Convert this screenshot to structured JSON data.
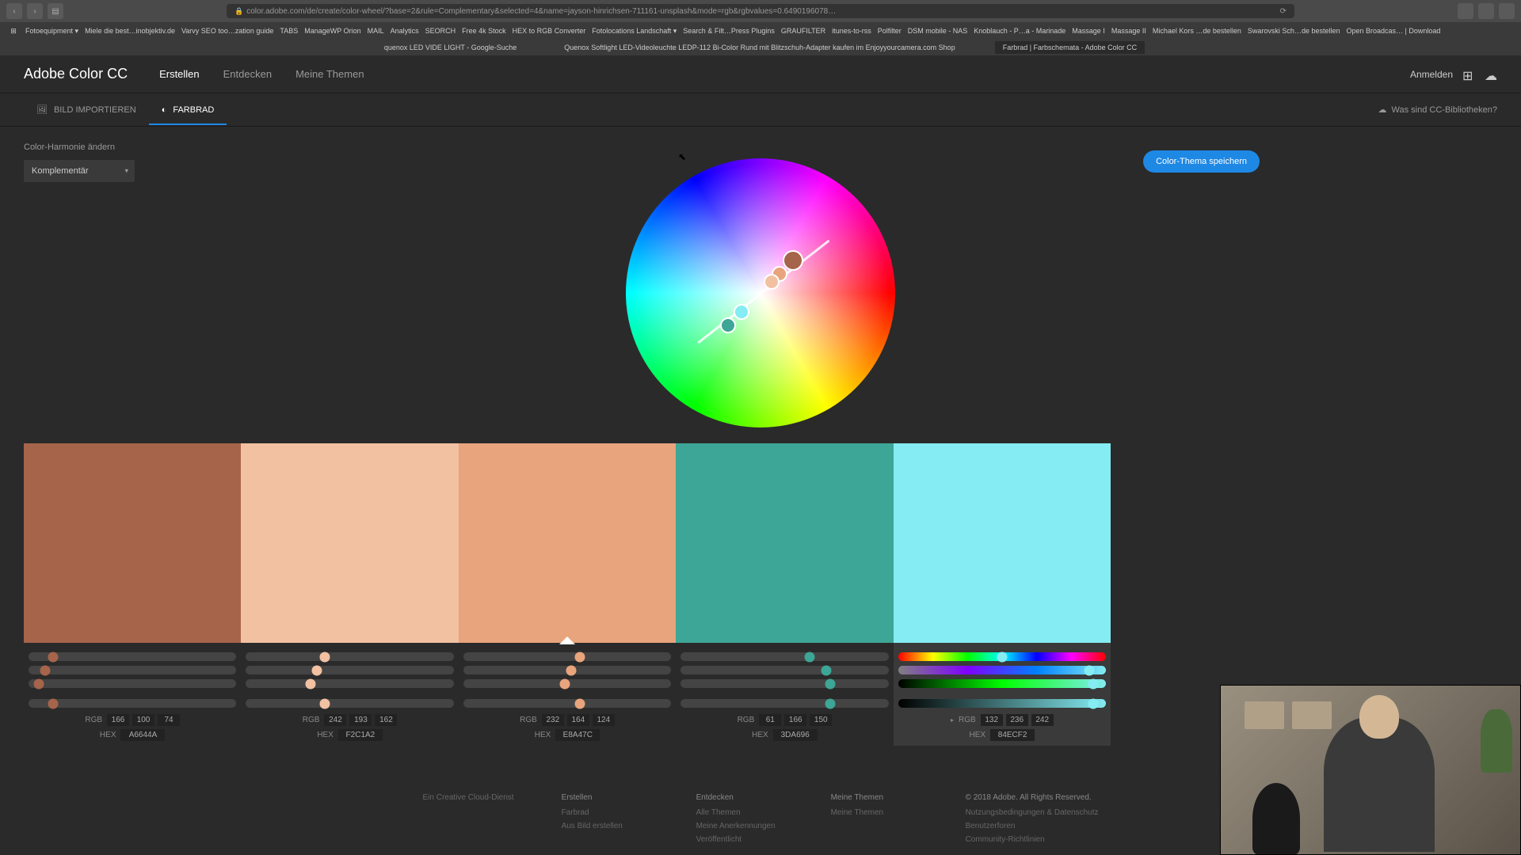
{
  "browser": {
    "url": "color.adobe.com/de/create/color-wheel/?base=2&rule=Complementary&selected=4&name=jayson-hinrichsen-711161-unsplash&mode=rgb&rgbvalues=0.6490196078…",
    "bookmarks": [
      "Fotoequipment ▾",
      "Miele die best…inobjektiv.de",
      "Varvy SEO too…zation guide",
      "TABS",
      "ManageWP Orion",
      "MAIL",
      "Analytics",
      "SEORCH",
      "Free 4k Stock",
      "HEX to RGB Converter",
      "Fotolocations Landschaft ▾",
      "Search & Filt…Press Plugins",
      "GRAUFILTER",
      "itunes-to-rss",
      "Polfilter",
      "DSM mobile - NAS",
      "Knoblauch - P…a - Marinade",
      "Massage I",
      "Massage II",
      "Michael Kors …de bestellen",
      "Swarovski Sch…de bestellen",
      "Open Broadcas… | Download"
    ],
    "tabs": [
      "quenox LED VIDE LIGHT - Google-Suche",
      "Quenox Softlight LED-Videoleuchte LEDP-112 Bi-Color Rund mit Blitzschuh-Adapter kaufen im Enjoyyourcamera.com Shop",
      "Farbrad | Farbschemata - Adobe Color CC"
    ]
  },
  "app": {
    "logo": "Adobe Color CC",
    "nav": [
      "Erstellen",
      "Entdecken",
      "Meine Themen"
    ],
    "login": "Anmelden"
  },
  "subtabs": {
    "import": "BILD IMPORTIEREN",
    "wheel": "FARBRAD",
    "cc_info": "Was sind CC-Bibliotheken?"
  },
  "controls": {
    "harmony_label": "Color-Harmonie ändern",
    "harmony_value": "Komplementär",
    "save_button": "Color-Thema speichern"
  },
  "swatches": [
    {
      "hex": "A6644A",
      "rgb": [
        166,
        100,
        74
      ]
    },
    {
      "hex": "F2C1A2",
      "rgb": [
        242,
        193,
        162
      ]
    },
    {
      "hex": "E8A47C",
      "rgb": [
        232,
        164,
        124
      ]
    },
    {
      "hex": "3DA696",
      "rgb": [
        61,
        166,
        150
      ]
    },
    {
      "hex": "84ECF2",
      "rgb": [
        132,
        236,
        242
      ]
    }
  ],
  "active_index": 4,
  "value_labels": {
    "rgb": "RGB",
    "hex": "HEX"
  },
  "footer": {
    "service": "Ein Creative Cloud-Dienst",
    "cols": [
      {
        "head": "Erstellen",
        "links": [
          "Farbrad",
          "Aus Bild erstellen"
        ]
      },
      {
        "head": "Entdecken",
        "links": [
          "Alle Themen",
          "Meine Anerkennungen",
          "Veröffentlicht"
        ]
      },
      {
        "head": "Meine Themen",
        "links": [
          "Meine Themen"
        ]
      },
      {
        "head": "© 2018 Adobe. All Rights Reserved.",
        "links": [
          "Nutzungsbedingungen   &   Datenschutz",
          "Benutzerforen",
          "Community-Richtlinien"
        ]
      }
    ]
  }
}
